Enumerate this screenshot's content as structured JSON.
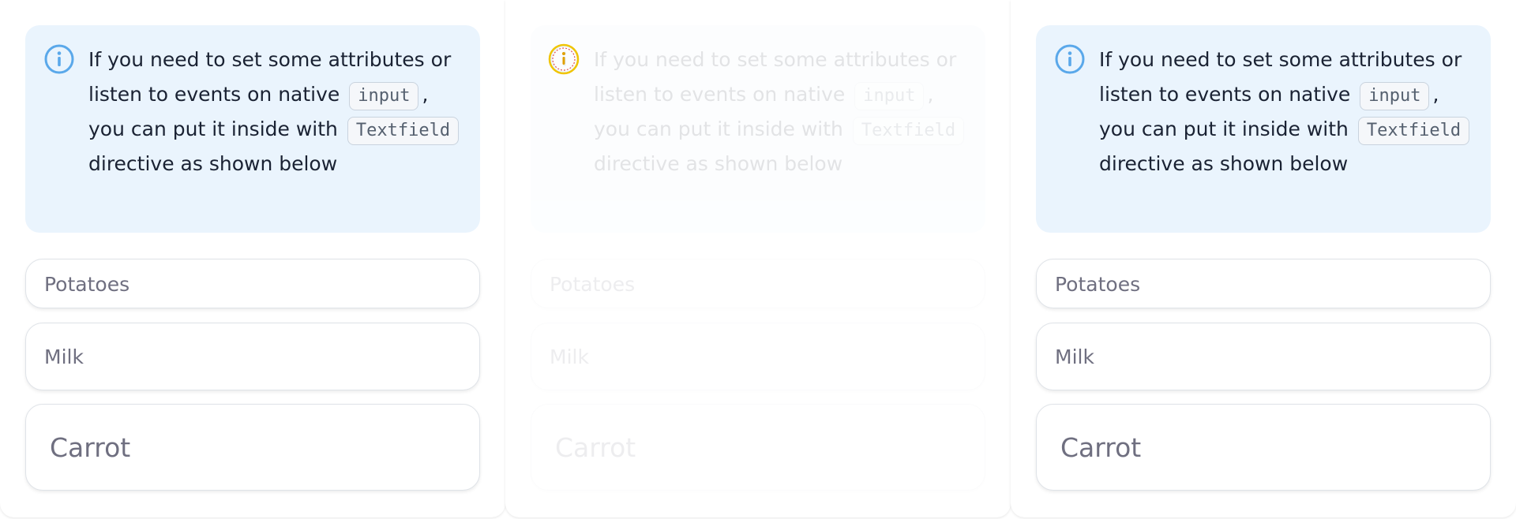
{
  "panels": [
    {
      "callout": {
        "text_1": "If you need to set some attributes or listen to events on native",
        "code_1": "input",
        "text_2": ", you can put it inside with",
        "code_2": "Textfield",
        "text_3": "directive as shown below"
      },
      "fields": [
        "Potatoes",
        "Milk",
        "Carrot"
      ]
    },
    {
      "callout": {
        "text_1": "If you need to set some attributes or listen to events on native",
        "code_1": "input",
        "text_2": ", you can put it inside with",
        "code_2": "Textfield",
        "text_3": "directive as shown below"
      },
      "fields": [
        "Potatoes",
        "Milk",
        "Carrot"
      ]
    },
    {
      "callout": {
        "text_1": "If you need to set some attributes or listen to events on native",
        "code_1": "input",
        "text_2": ", you can put it inside with",
        "code_2": "Textfield",
        "text_3": "directive as shown below"
      },
      "fields": [
        "Potatoes",
        "Milk",
        "Carrot"
      ]
    }
  ],
  "colors": {
    "callout_bg": "#eaf4fd",
    "info_icon": "#5aa8ea",
    "focus_ring": "#f0c400",
    "text": "#1a2233",
    "field_text": "#6f6f80"
  }
}
